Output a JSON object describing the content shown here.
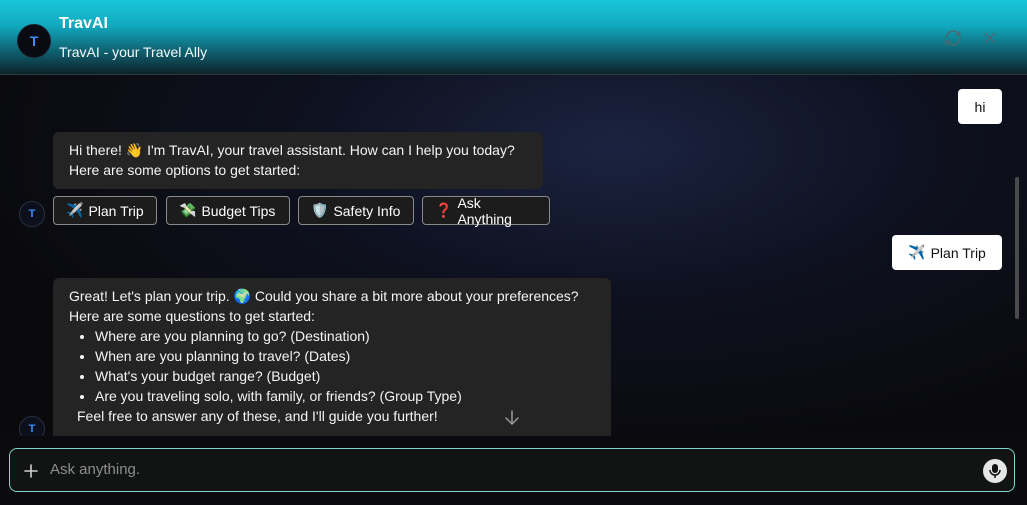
{
  "header": {
    "avatar_letter": "T",
    "title": "TravAI",
    "subtitle": "TravAI - your Travel Ally",
    "refresh_icon": "refresh-icon",
    "close_icon": "close-icon"
  },
  "messages": {
    "user_1": "hi",
    "bot_1_line1": "Hi there! 👋 I'm TravAI, your travel assistant. How can I help you today?",
    "bot_1_line2": "Here are some options to get started:",
    "options": [
      {
        "emoji": "✈️",
        "label": "Plan Trip"
      },
      {
        "emoji": "💸",
        "label": "Budget Tips"
      },
      {
        "emoji": "🛡️",
        "label": "Safety Info"
      },
      {
        "emoji": "❓",
        "label": "Ask Anything"
      }
    ],
    "user_2_emoji": "✈️",
    "user_2": "Plan Trip",
    "bot_2_line1": "Great! Let's plan your trip. 🌍 Could you share a bit more about your preferences?",
    "bot_2_line2": "Here are some questions to get started:",
    "bot_2_list": [
      "Where are you planning to go? (Destination)",
      "When are you planning to travel? (Dates)",
      "What's your budget range? (Budget)",
      "Are you traveling solo, with family, or friends? (Group Type)"
    ],
    "bot_2_footer": "Feel free to answer any of these, and I'll guide you further!"
  },
  "input": {
    "placeholder": "Ask anything.",
    "plus_icon": "plus-icon",
    "mic_icon": "microphone-icon"
  },
  "colors": {
    "header_top": "#19c6dc",
    "accent_border": "#7fd3c9",
    "avatar_letter": "#3a8cff"
  }
}
